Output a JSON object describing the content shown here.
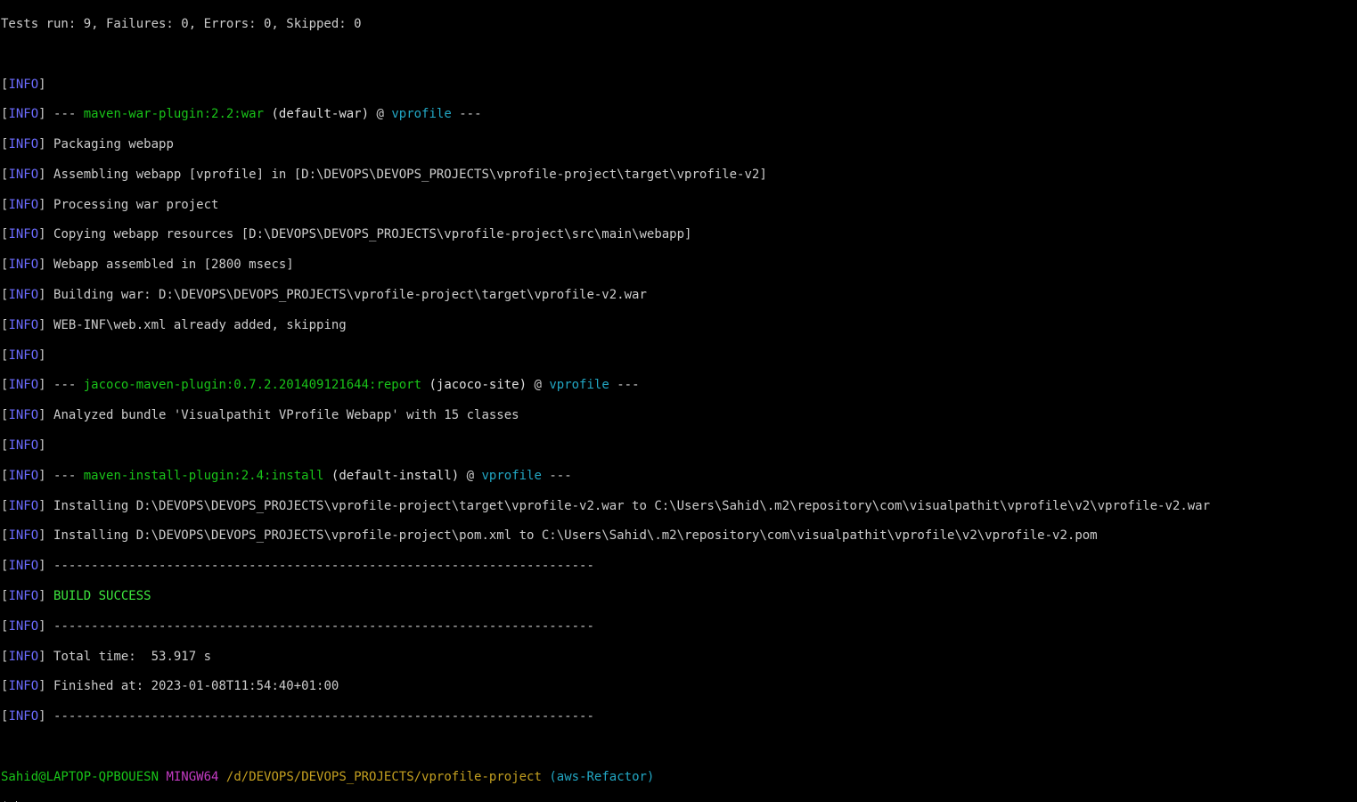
{
  "tests_summary": "Tests run: 9, Failures: 0, Errors: 0, Skipped: 0",
  "tag": "INFO",
  "lines": {
    "war_plugin": "maven-war-plugin:2.2:war",
    "war_goal": "(default-war)",
    "project": "vprofile",
    "packaging": "Packaging webapp",
    "assembling": "Assembling webapp [vprofile] in [D:\\DEVOPS\\DEVOPS_PROJECTS\\vprofile-project\\target\\vprofile-v2]",
    "processing": "Processing war project",
    "copying": "Copying webapp resources [D:\\DEVOPS\\DEVOPS_PROJECTS\\vprofile-project\\src\\main\\webapp]",
    "assembled": "Webapp assembled in [2800 msecs]",
    "building": "Building war: D:\\DEVOPS\\DEVOPS_PROJECTS\\vprofile-project\\target\\vprofile-v2.war",
    "webinf": "WEB-INF\\web.xml already added, skipping",
    "jacoco_plugin": "jacoco-maven-plugin:0.7.2.201409121644:report",
    "jacoco_goal": "(jacoco-site)",
    "analyzed": "Analyzed bundle 'Visualpathit VProfile Webapp' with 15 classes",
    "install_plugin": "maven-install-plugin:2.4:install",
    "install_goal": "(default-install)",
    "installing_war": "Installing D:\\DEVOPS\\DEVOPS_PROJECTS\\vprofile-project\\target\\vprofile-v2.war to C:\\Users\\Sahid\\.m2\\repository\\com\\visualpathit\\vprofile\\v2\\vprofile-v2.war",
    "installing_pom": "Installing D:\\DEVOPS\\DEVOPS_PROJECTS\\vprofile-project\\pom.xml to C:\\Users\\Sahid\\.m2\\repository\\com\\visualpathit\\vprofile\\v2\\vprofile-v2.pom",
    "separator": "------------------------------------------------------------------------",
    "build_success": "BUILD SUCCESS",
    "total_time": "Total time:  53.917 s",
    "finished_at": "Finished at: 2023-01-08T11:54:40+01:00"
  },
  "prompt": {
    "user_host": "Sahid@LAPTOP-QPBOUESN",
    "system": "MINGW64",
    "path": "/d/DEVOPS/DEVOPS_PROJECTS/vprofile-project",
    "branch": "(aws-Refactor)",
    "symbol": "$"
  },
  "colors": {
    "background": "#000000",
    "text": "#cccccc",
    "info_tag": "#6c6cff",
    "plugin": "#19c419",
    "success": "#3ee63e",
    "project": "#22a7c4",
    "system": "#c43bc4",
    "path": "#c4a020"
  }
}
